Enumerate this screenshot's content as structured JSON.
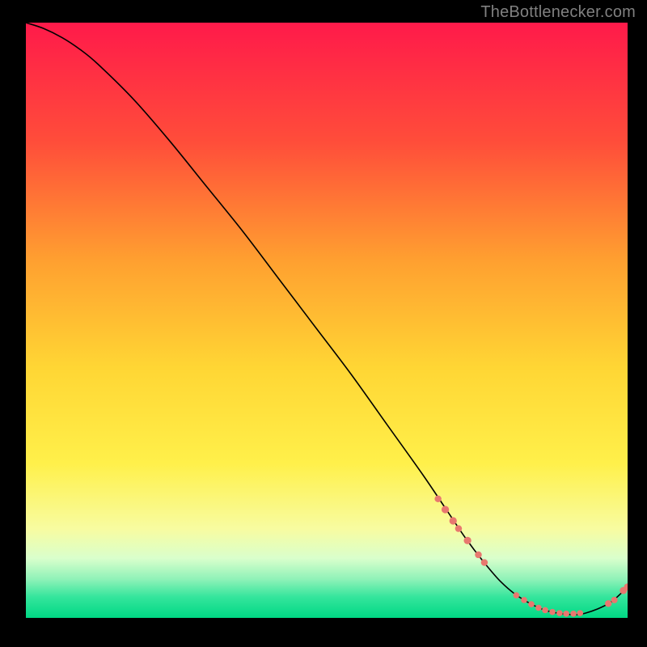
{
  "watermark": "TheBottlenecker.com",
  "colors": {
    "bg": "#000000",
    "curve": "#000000",
    "marker": "#e8786f",
    "watermark": "#808080"
  },
  "chart_data": {
    "type": "line",
    "title": "",
    "xlabel": "",
    "ylabel": "",
    "xlim": [
      0,
      100
    ],
    "ylim": [
      0,
      100
    ],
    "background_gradient_stops": [
      {
        "offset": 0.0,
        "color": "#ff1a4a"
      },
      {
        "offset": 0.2,
        "color": "#ff4d3a"
      },
      {
        "offset": 0.4,
        "color": "#ffa030"
      },
      {
        "offset": 0.58,
        "color": "#ffd634"
      },
      {
        "offset": 0.74,
        "color": "#fff04a"
      },
      {
        "offset": 0.85,
        "color": "#f8fca0"
      },
      {
        "offset": 0.9,
        "color": "#d9ffcc"
      },
      {
        "offset": 0.935,
        "color": "#8ff2b8"
      },
      {
        "offset": 0.965,
        "color": "#34e59c"
      },
      {
        "offset": 1.0,
        "color": "#00d884"
      }
    ],
    "series": [
      {
        "name": "bottleneck-curve",
        "x": [
          0,
          3,
          6,
          9,
          12,
          18,
          24,
          30,
          36,
          42,
          48,
          54,
          60,
          66,
          70,
          73,
          76,
          79,
          82,
          86,
          90,
          93,
          97,
          100
        ],
        "y": [
          100,
          99,
          97.5,
          95.5,
          93,
          87,
          80,
          72.5,
          65,
          57,
          49,
          41,
          32.5,
          24,
          18,
          13.5,
          9.5,
          6,
          3.5,
          1.4,
          0.6,
          0.8,
          2.5,
          5.2
        ]
      }
    ],
    "markers": {
      "name": "highlighted-points",
      "color": "#e8786f",
      "points": [
        {
          "x": 68.5,
          "y": 20.0,
          "r": 4.2
        },
        {
          "x": 69.7,
          "y": 18.2,
          "r": 4.6
        },
        {
          "x": 71.0,
          "y": 16.3,
          "r": 4.6
        },
        {
          "x": 71.9,
          "y": 15.0,
          "r": 4.2
        },
        {
          "x": 73.4,
          "y": 13.0,
          "r": 4.6
        },
        {
          "x": 75.2,
          "y": 10.6,
          "r": 4.2
        },
        {
          "x": 76.2,
          "y": 9.3,
          "r": 4.2
        },
        {
          "x": 81.5,
          "y": 3.8,
          "r": 3.8
        },
        {
          "x": 82.8,
          "y": 3.0,
          "r": 3.8
        },
        {
          "x": 84.0,
          "y": 2.3,
          "r": 3.8
        },
        {
          "x": 85.2,
          "y": 1.7,
          "r": 3.8
        },
        {
          "x": 86.3,
          "y": 1.3,
          "r": 3.8
        },
        {
          "x": 87.5,
          "y": 1.0,
          "r": 3.8
        },
        {
          "x": 88.7,
          "y": 0.8,
          "r": 3.8
        },
        {
          "x": 89.8,
          "y": 0.7,
          "r": 3.8
        },
        {
          "x": 91.0,
          "y": 0.7,
          "r": 3.8
        },
        {
          "x": 92.1,
          "y": 0.8,
          "r": 3.8
        },
        {
          "x": 96.8,
          "y": 2.4,
          "r": 4.2
        },
        {
          "x": 97.8,
          "y": 3.0,
          "r": 4.0
        },
        {
          "x": 99.3,
          "y": 4.6,
          "r": 4.4
        },
        {
          "x": 100.0,
          "y": 5.2,
          "r": 4.4
        }
      ]
    }
  }
}
